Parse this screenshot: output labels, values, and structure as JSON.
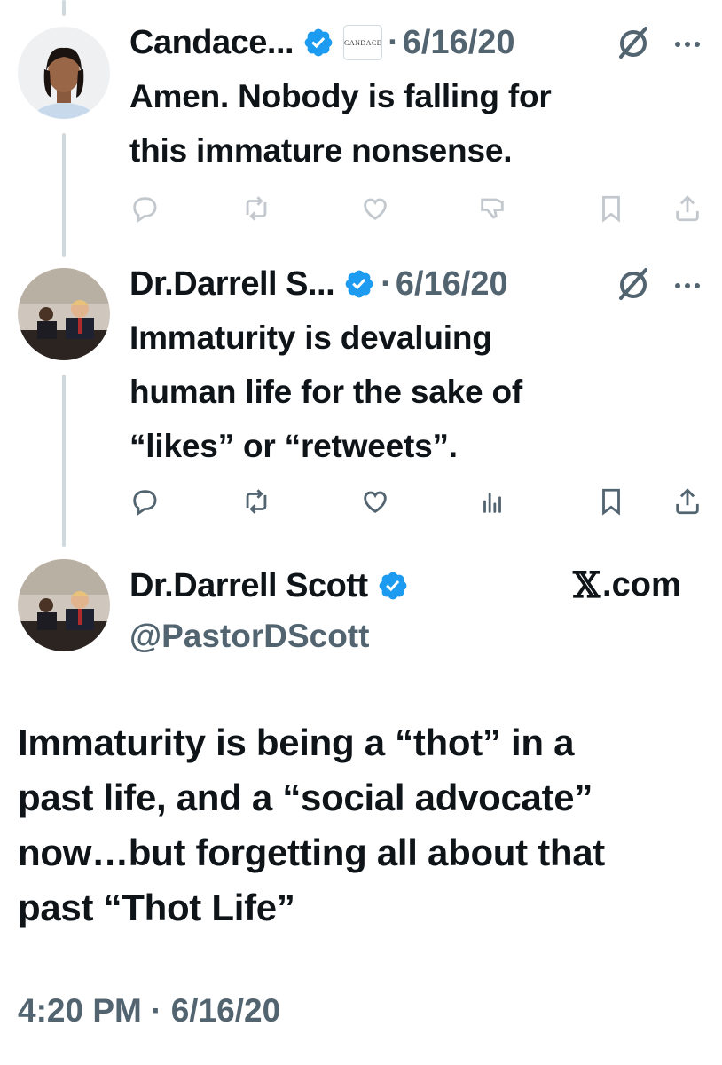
{
  "tweets": [
    {
      "name": "Candace...",
      "affiliation": "CANDACE",
      "date": "6/16/20",
      "lines": [
        "Amen. Nobody is falling for",
        "this immature nonsense."
      ]
    },
    {
      "name": "Dr.Darrell S...",
      "date": "6/16/20",
      "lines": [
        "Immaturity is devaluing",
        "human life for the sake of",
        "“likes” or “retweets”."
      ]
    }
  ],
  "main": {
    "name": "Dr.Darrell Scott",
    "handle": "@PastorDScott",
    "watermark": ".com",
    "lines": [
      "Immaturity is being a “thot” in a",
      "past life, and a “social advocate”",
      "now…but forgetting  all about that",
      "past  “Thot Life”"
    ],
    "timestamp": "4:20 PM · 6/16/20"
  },
  "separator": "·",
  "icons": [
    "verified-badge-icon",
    "grok-icon",
    "more-icon",
    "reply-icon",
    "retweet-icon",
    "like-icon",
    "views-icon",
    "bookmark-icon",
    "share-icon",
    "x-logo-icon"
  ],
  "colors": {
    "verified": "#1d9bf0",
    "muted": "#536471",
    "text": "#0f1419",
    "thread_line": "#cfd9de"
  }
}
